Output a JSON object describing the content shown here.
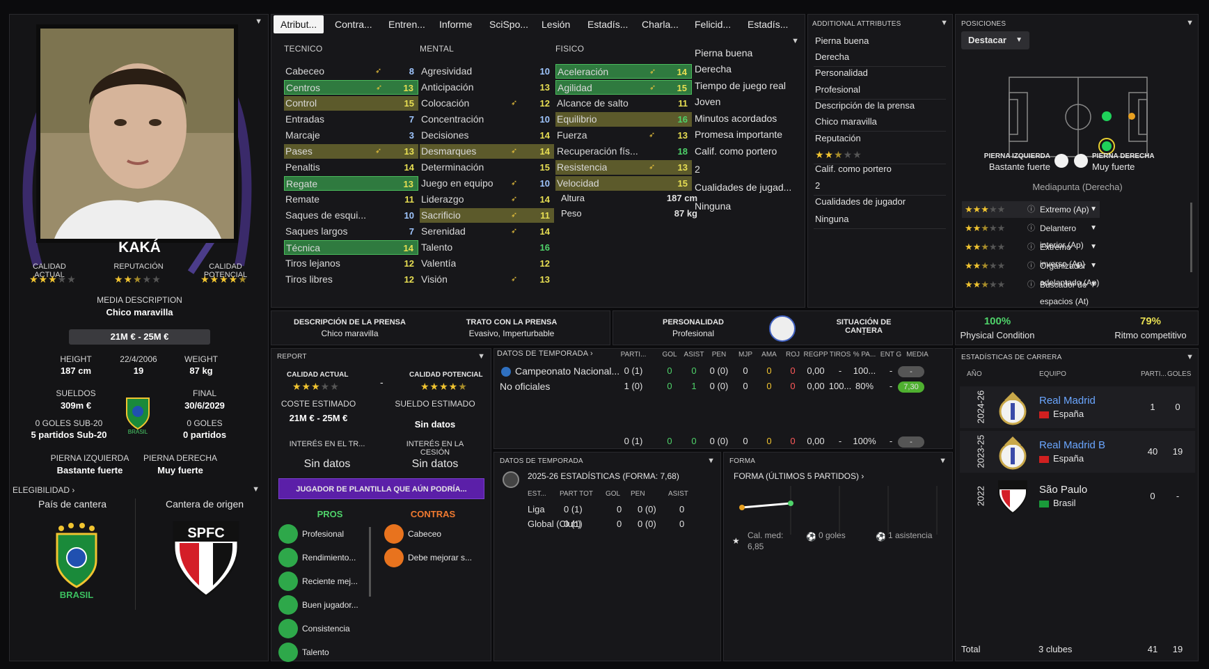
{
  "tabs": [
    "Atribut...",
    "Contra...",
    "Entren...",
    "Informe",
    "SciSpo...",
    "Lesión",
    "Estadís...",
    "Charla...",
    "Felicid...",
    "Estadís..."
  ],
  "player": {
    "name": "KAKÁ",
    "calidad_actual_label": "CALIDAD ACTUAL",
    "reputacion_label": "REPUTACIÓN",
    "calidad_potencial_label": "CALIDAD POTENCIAL",
    "calidad_actual_stars": 3,
    "reputacion_stars": 2.5,
    "calidad_potencial_stars": 4.5,
    "media_desc_label": "MEDIA DESCRIPTION",
    "media_desc": "Chico maravilla",
    "value": "21M € - 25M €",
    "height_label": "HEIGHT",
    "height": "187 cm",
    "dob": "22/4/2006",
    "age": "19",
    "weight_label": "WEIGHT",
    "weight": "87 kg",
    "sueldos_label": "SUELDOS",
    "sueldos": "309m €",
    "final_label": "FINAL",
    "final": "30/6/2029",
    "goles_sub20_label": "0 GOLES SUB-20",
    "partidos_sub20": "5 partidos Sub-20",
    "goles_label": "0 GOLES",
    "partidos": "0 partidos",
    "pierna_izq_label": "PIERNA IZQUIERDA",
    "pierna_izq": "Bastante fuerte",
    "pierna_der_label": "PIERNA DERECHA",
    "pierna_der": "Muy fuerte",
    "elegibilidad": "ELEGIBILIDAD",
    "pais_cantera_label": "País de cantera",
    "cantera_origen_label": "Cantera de origen",
    "brasil": "BRASIL",
    "spfc": "SPFC"
  },
  "tecnico": {
    "title": "TECNICO",
    "rows": [
      {
        "n": "Cabeceo",
        "v": "8",
        "a": true,
        "h": "",
        "c": "b"
      },
      {
        "n": "Centros",
        "v": "13",
        "a": true,
        "h": "g",
        "c": "y"
      },
      {
        "n": "Control",
        "v": "15",
        "a": false,
        "h": "y",
        "c": "y"
      },
      {
        "n": "Entradas",
        "v": "7",
        "a": false,
        "h": "",
        "c": "b"
      },
      {
        "n": "Marcaje",
        "v": "3",
        "a": false,
        "h": "",
        "c": "b"
      },
      {
        "n": "Pases",
        "v": "13",
        "a": true,
        "h": "y",
        "c": "y"
      },
      {
        "n": "Penaltis",
        "v": "14",
        "a": false,
        "h": "",
        "c": "y"
      },
      {
        "n": "Regate",
        "v": "13",
        "a": false,
        "h": "g",
        "c": "y"
      },
      {
        "n": "Remate",
        "v": "11",
        "a": false,
        "h": "",
        "c": "y"
      },
      {
        "n": "Saques de esqui...",
        "v": "10",
        "a": false,
        "h": "",
        "c": "b"
      },
      {
        "n": "Saques largos",
        "v": "7",
        "a": false,
        "h": "",
        "c": "b"
      },
      {
        "n": "Técnica",
        "v": "14",
        "a": false,
        "h": "g",
        "c": "y"
      },
      {
        "n": "Tiros lejanos",
        "v": "12",
        "a": false,
        "h": "",
        "c": "y"
      },
      {
        "n": "Tiros libres",
        "v": "12",
        "a": false,
        "h": "",
        "c": "y"
      }
    ]
  },
  "mental": {
    "title": "MENTAL",
    "rows": [
      {
        "n": "Agresividad",
        "v": "10",
        "a": false,
        "h": "",
        "c": "b"
      },
      {
        "n": "Anticipación",
        "v": "13",
        "a": false,
        "h": "",
        "c": "y"
      },
      {
        "n": "Colocación",
        "v": "12",
        "a": true,
        "h": "",
        "c": "y"
      },
      {
        "n": "Concentración",
        "v": "10",
        "a": false,
        "h": "",
        "c": "b"
      },
      {
        "n": "Decisiones",
        "v": "14",
        "a": false,
        "h": "",
        "c": "y"
      },
      {
        "n": "Desmarques",
        "v": "14",
        "a": true,
        "h": "y",
        "c": "y"
      },
      {
        "n": "Determinación",
        "v": "15",
        "a": false,
        "h": "",
        "c": "y"
      },
      {
        "n": "Juego en equipo",
        "v": "10",
        "a": true,
        "h": "",
        "c": "b"
      },
      {
        "n": "Liderazgo",
        "v": "14",
        "a": true,
        "h": "",
        "c": "y"
      },
      {
        "n": "Sacrificio",
        "v": "11",
        "a": true,
        "h": "y",
        "c": "y"
      },
      {
        "n": "Serenidad",
        "v": "14",
        "a": true,
        "h": "",
        "c": "y"
      },
      {
        "n": "Talento",
        "v": "16",
        "a": false,
        "h": "",
        "c": "g"
      },
      {
        "n": "Valentía",
        "v": "12",
        "a": false,
        "h": "",
        "c": "y"
      },
      {
        "n": "Visión",
        "v": "13",
        "a": true,
        "h": "",
        "c": "y"
      }
    ]
  },
  "fisico": {
    "title": "FISICO",
    "rows": [
      {
        "n": "Aceleración",
        "v": "14",
        "a": true,
        "h": "g",
        "c": "y"
      },
      {
        "n": "Agilidad",
        "v": "15",
        "a": true,
        "h": "g",
        "c": "y"
      },
      {
        "n": "Alcance de salto",
        "v": "11",
        "a": false,
        "h": "",
        "c": "y"
      },
      {
        "n": "Equilibrio",
        "v": "16",
        "a": false,
        "h": "y",
        "c": "g"
      },
      {
        "n": "Fuerza",
        "v": "13",
        "a": true,
        "h": "",
        "c": "y"
      },
      {
        "n": "Recuperación fís...",
        "v": "18",
        "a": false,
        "h": "",
        "c": "g"
      },
      {
        "n": "Resistencia",
        "v": "13",
        "a": true,
        "h": "y",
        "c": "y"
      },
      {
        "n": "Velocidad",
        "v": "15",
        "a": false,
        "h": "y",
        "c": "y"
      }
    ],
    "altura_label": "Altura",
    "altura": "187 cm",
    "peso_label": "Peso",
    "peso": "87 kg"
  },
  "extra_col": [
    "Pierna buena",
    "Derecha",
    "Tiempo de juego real",
    "Joven",
    "Minutos acordados",
    "Promesa importante",
    "Calif. como portero",
    "2",
    "Cualidades de jugad...",
    "Ninguna"
  ],
  "additional": {
    "title": "ADDITIONAL ATTRIBUTES",
    "rows": [
      "Pierna buena",
      "Derecha",
      "Personalidad",
      "Profesional",
      "Descripción de la prensa",
      "Chico maravilla",
      "Reputación",
      "",
      "Calif. como portero",
      "2",
      "Cualidades de jugador",
      "Ninguna"
    ]
  },
  "posiciones": {
    "title": "POSICIONES",
    "button": "Destacar",
    "pierna_izq_label": "PIERNA IZQUIERDA",
    "pierna_izq": "Bastante fuerte",
    "pierna_der_label": "PIERNA DERECHA",
    "pierna_der": "Muy fuerte",
    "role": "Mediapunta (Derecha)",
    "items": [
      {
        "s": 3,
        "n": "Extremo (Ap)"
      },
      {
        "s": 2.5,
        "n": "Delantero interior (Ap)"
      },
      {
        "s": 2.5,
        "n": "Extremo inverso (Ap)"
      },
      {
        "s": 2.5,
        "n": "Organizador adelantado (Ap)"
      },
      {
        "s": 2.5,
        "n": "Buscador de espacios (At)"
      }
    ]
  },
  "press": {
    "desc_label": "DESCRIPCIÓN DE LA PRENSA",
    "desc": "Chico maravilla",
    "trato_label": "TRATO CON LA PRENSA",
    "trato": "Evasivo, Imperturbable"
  },
  "personalidad": {
    "label": "PERSONALIDAD",
    "val": "Profesional",
    "cantera_label": "SITUACIÓN DE CANTERA",
    "cantera": "-"
  },
  "condition": {
    "pc": "100%",
    "pc_label": "Physical Condition",
    "rc": "79%",
    "rc_label": "Ritmo competitivo"
  },
  "report": {
    "title": "REPORT",
    "ca_label": "CALIDAD ACTUAL",
    "cp_label": "CALIDAD POTENCIAL",
    "dash": "-",
    "coste_label": "COSTE ESTIMADO",
    "coste": "21M € - 25M €",
    "sueldo_label": "SUELDO ESTIMADO",
    "sueldo": "Sin datos",
    "interes_tr_label": "INTERÉS EN EL TR...",
    "interes_tr": "Sin datos",
    "interes_ces_label": "INTERÉS EN LA CESIÓN",
    "interes_ces": "Sin datos",
    "banner": "JUGADOR DE PLANTILLA QUE AÚN PODRÍA...",
    "pros_label": "PROS",
    "contras_label": "CONTRAS",
    "pros": [
      "Profesional",
      "Rendimiento...",
      "Reciente mej...",
      "Buen jugador...",
      "Consistencia",
      "Talento"
    ],
    "contras": [
      "Cabeceo",
      "Debe mejorar s..."
    ]
  },
  "season": {
    "title": "DATOS DE TEMPORADA",
    "heads": [
      "PARTI...",
      "GOL",
      "ASIST",
      "PEN",
      "MJP",
      "AMA",
      "ROJ",
      "REGPP",
      "TIROS",
      "% PA...",
      "ENT G",
      "MEDIA"
    ],
    "rows": [
      {
        "comp": "Campeonato Nacional...",
        "c": [
          "0 (1)",
          "0",
          "0",
          "0 (0)",
          "0",
          "0",
          "0",
          "0,00",
          "-",
          "100...",
          "-"
        ],
        "m": "-"
      },
      {
        "comp": "No oficiales",
        "c": [
          "1 (0)",
          "0",
          "1",
          "0 (0)",
          "0",
          "0",
          "0",
          "0,00",
          "100...",
          "80%",
          "-"
        ],
        "m": "7,30"
      }
    ],
    "total": [
      "0 (1)",
      "0",
      "0",
      "0 (0)",
      "0",
      "0",
      "0",
      "0,00",
      "-",
      "100%",
      "-"
    ],
    "total_m": "-"
  },
  "season2": {
    "title": "DATOS DE TEMPORADA",
    "sub": "2025-26 ESTADÍSTICAS (FORMA: 7,68)",
    "heads": [
      "EST...",
      "PART TOT",
      "GOL",
      "PEN",
      "ASIST"
    ],
    "rows": [
      [
        "Liga",
        "0 (1)",
        "0",
        "0 (0)",
        "0"
      ],
      [
        "Global (Club)",
        "0 (1)",
        "0",
        "0 (0)",
        "0"
      ]
    ]
  },
  "forma": {
    "title": "FORMA",
    "sub": "FORMA (ÚLTIMOS 5 PARTIDOS)",
    "cal": "Cal. med:",
    "cal_val": "6,85",
    "goles": "0 goles",
    "asist": "1 asistencia"
  },
  "career": {
    "title": "ESTADÍSTICAS DE CARRERA",
    "h_year": "AÑO",
    "h_team": "EQUIPO",
    "h_part": "PARTI...",
    "h_goles": "GOLES",
    "rows": [
      {
        "y": "2024-26",
        "t": "Real Madrid",
        "c": "España",
        "p": "1",
        "g": "0",
        "link": true
      },
      {
        "y": "2023-25",
        "t": "Real Madrid B",
        "c": "España",
        "p": "40",
        "g": "19",
        "link": true
      },
      {
        "y": "2022",
        "t": "São Paulo",
        "c": "Brasil",
        "p": "0",
        "g": "-",
        "link": false
      }
    ],
    "total_label": "Total",
    "total_clubs": "3 clubes",
    "total_p": "41",
    "total_g": "19"
  }
}
